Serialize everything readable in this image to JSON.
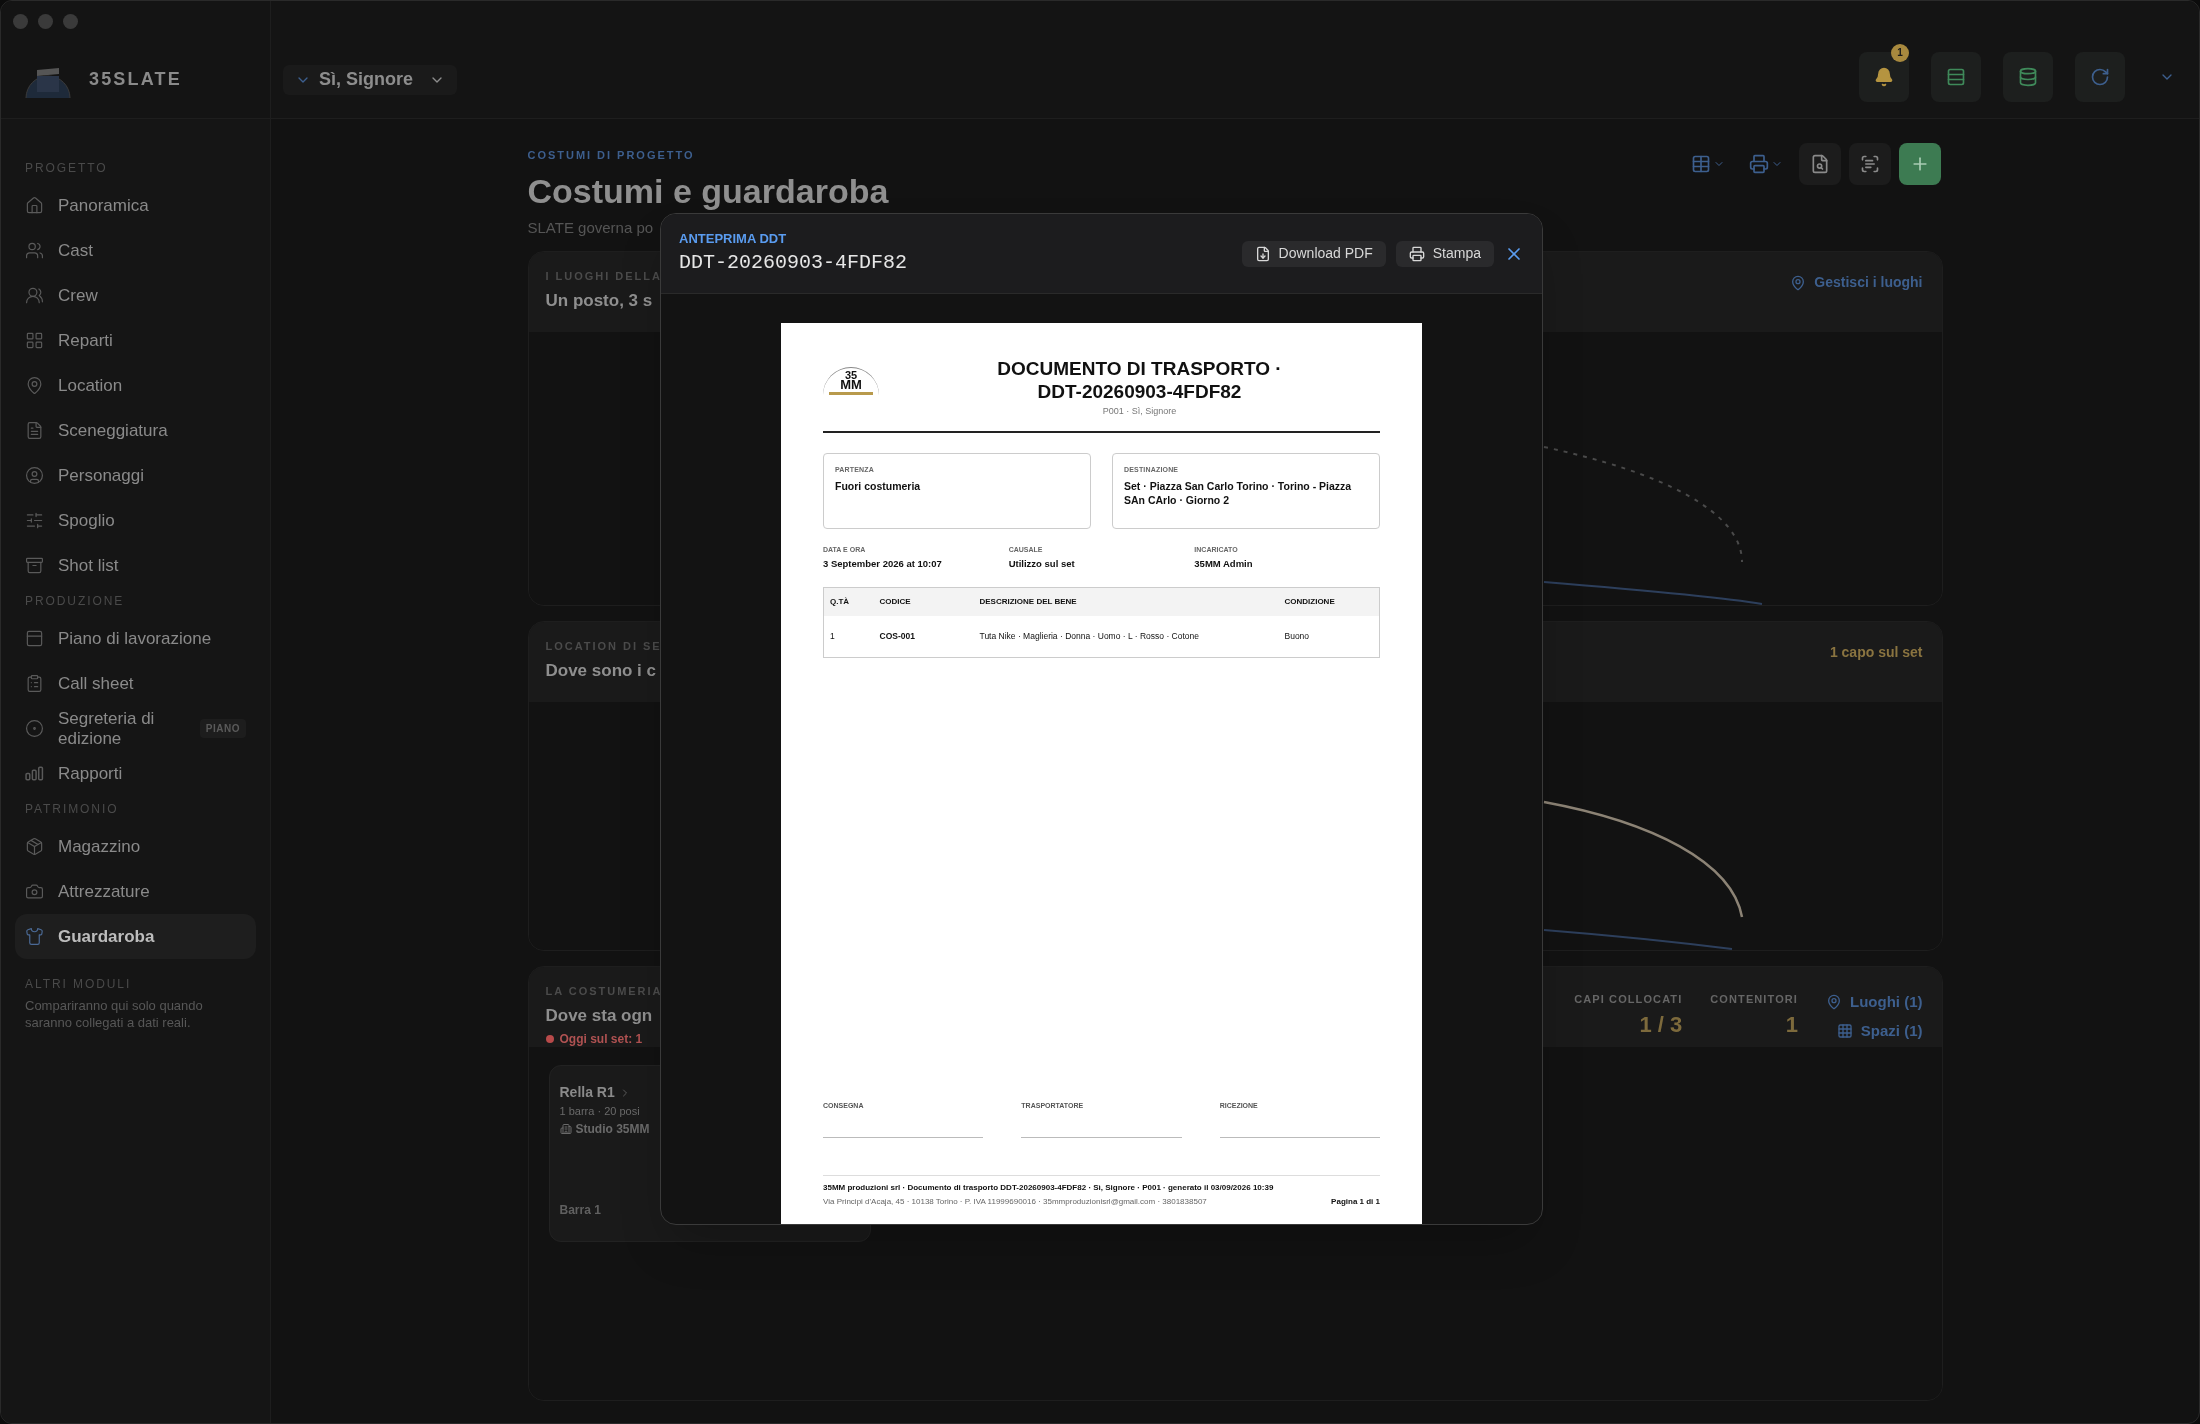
{
  "app": {
    "name": "35SLATE"
  },
  "project_selector": {
    "label": "Sì, Signore"
  },
  "header_actions": [
    {
      "kind": "bell",
      "badge": "1"
    },
    {
      "kind": "table"
    },
    {
      "kind": "database"
    },
    {
      "kind": "refresh"
    },
    {
      "kind": "menu"
    }
  ],
  "sidebar": {
    "sections": [
      {
        "title": "PROGETTO",
        "items": [
          {
            "label": "Panoramica",
            "selected": false
          },
          {
            "label": "Cast",
            "selected": false
          },
          {
            "label": "Crew",
            "selected": false
          },
          {
            "label": "Reparti",
            "selected": false
          },
          {
            "label": "Location",
            "selected": false
          },
          {
            "label": "Sceneggiatura",
            "selected": false
          },
          {
            "label": "Personaggi",
            "selected": false
          },
          {
            "label": "Spoglio",
            "selected": false
          },
          {
            "label": "Shot list",
            "selected": false
          }
        ]
      },
      {
        "title": "PRODUZIONE",
        "items": [
          {
            "label": "Piano di lavorazione",
            "selected": false
          },
          {
            "label": "Call sheet",
            "selected": false
          },
          {
            "label": "Segreteria di edizione",
            "selected": false,
            "badge": "PIANO"
          },
          {
            "label": "Rapporti",
            "selected": false
          }
        ]
      },
      {
        "title": "PATRIMONIO",
        "items": [
          {
            "label": "Magazzino",
            "selected": false
          },
          {
            "label": "Attrezzature",
            "selected": false
          },
          {
            "label": "Guardaroba",
            "selected": true
          }
        ]
      }
    ],
    "footer": {
      "title": "ALTRI MODULI",
      "text": "Compariranno qui solo quando saranno collegati a dati reali."
    }
  },
  "page": {
    "eyebrow": "COSTUMI DI PROGETTO",
    "title": "Costumi e guardaroba",
    "subtitle": "SLATE governa po",
    "toolbar": [
      {
        "kind": "table"
      },
      {
        "kind": "print"
      },
      {
        "kind": "search-doc"
      },
      {
        "kind": "scan"
      },
      {
        "kind": "add"
      }
    ],
    "cards": [
      {
        "eyebrow": "I LUOGHI DELLA",
        "title": "Un posto, 3 s",
        "action": {
          "kind": "link",
          "label": "Gestisci i luoghi"
        }
      },
      {
        "eyebrow": "LOCATION DI SE",
        "title": "Dove sono i c",
        "action": {
          "kind": "note",
          "label": "1 capo sul set"
        }
      },
      {
        "eyebrow": "LA COSTUMERIA",
        "title": "Dove sta ogn",
        "status": {
          "label": "Oggi sul set: 1",
          "color": "#b84a4a"
        },
        "stats": [
          {
            "label": "CAPI COLLOCATI",
            "value": "1 / 3"
          },
          {
            "label": "CONTENITORI",
            "value": "1"
          }
        ],
        "links": [
          {
            "label": "Luoghi (1)"
          },
          {
            "label": "Spazi (1)"
          }
        ],
        "rack": {
          "title": "Rella R1",
          "meta": "1 barra · 20 posi",
          "place": "Studio 35MM",
          "bar": "Barra 1"
        }
      }
    ]
  },
  "modal": {
    "eyebrow": "ANTEPRIMA DDT",
    "title": "DDT-20260903-4FDF82",
    "buttons": [
      {
        "label": "Download PDF"
      },
      {
        "label": "Stampa"
      }
    ],
    "document": {
      "logo": [
        "35",
        "MM"
      ],
      "title": "DOCUMENTO DI TRASPORTO · DDT-20260903-4FDF82",
      "subtitle": "P001 · Sì, Signore",
      "parties": [
        {
          "label": "PARTENZA",
          "value": "Fuori costumeria"
        },
        {
          "label": "DESTINAZIONE",
          "value": "Set · Piazza San Carlo Torino · Torino - Piazza SAn CArlo · Giorno 2"
        }
      ],
      "meta": [
        {
          "label": "DATA E ORA",
          "value": "3 September 2026 at 10:07"
        },
        {
          "label": "CAUSALE",
          "value": "Utilizzo sul set"
        },
        {
          "label": "INCARICATO",
          "value": "35MM Admin"
        }
      ],
      "table": {
        "columns": [
          "Q.TÀ",
          "CODICE",
          "DESCRIZIONE DEL BENE",
          "CONDIZIONE"
        ],
        "rows": [
          [
            "1",
            "COS-001",
            "Tuta Nike · Maglieria · Donna · Uomo · L · Rosso · Cotone",
            "Buono"
          ]
        ]
      },
      "signatures": [
        "CONSEGNA",
        "TRASPORTATORE",
        "RICEZIONE"
      ],
      "footer": {
        "line1": "35MM produzioni srl · Documento di trasporto DDT-20260903-4FDF82 · Sì, Signore · P001 · generato il 03/09/2026 10:39",
        "line2": "Via Principi d'Acaja, 45 · 10138 Torino · P. IVA 11999690016 · 35mmproduzionisrl@gmail.com · 3801838507",
        "page": "Pagina 1 di 1"
      }
    }
  }
}
